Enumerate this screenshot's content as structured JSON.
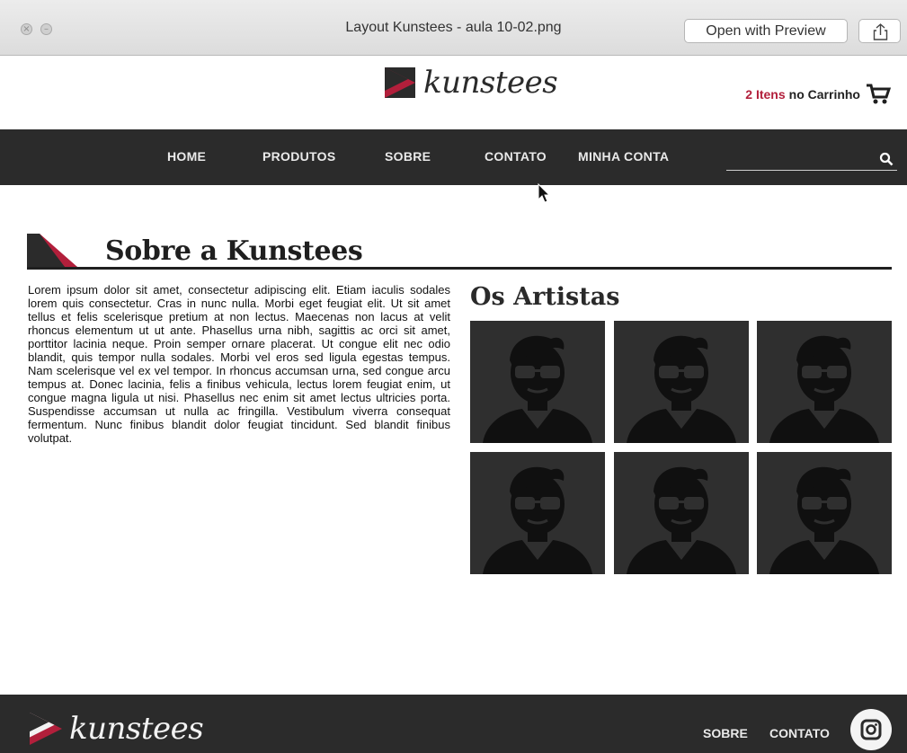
{
  "window": {
    "title": "Layout Kunstees - aula 10-02.png",
    "open_with_preview": "Open with Preview"
  },
  "brand": {
    "name": "kunstees",
    "accent_color": "#b21f3b",
    "dark_color": "#2b2b2b"
  },
  "header": {
    "cart_count": "2 Itens",
    "cart_label": "no Carrinho"
  },
  "nav": {
    "items": [
      "HOME",
      "PRODUTOS",
      "SOBRE",
      "CONTATO",
      "MINHA CONTA"
    ],
    "search_placeholder": ""
  },
  "about": {
    "title": "Sobre a Kunstees",
    "text": "Lorem ipsum dolor sit amet, consectetur adipiscing elit. Etiam iaculis sodales lorem quis consectetur. Cras in nunc nulla. Morbi eget feugiat elit. Ut sit amet tellus et felis scelerisque pretium at non lectus. Maecenas non lacus at velit rhoncus el­ementum ut ut ante. Phasellus urna nibh, sagittis ac orci sit amet, porttitor lacinia neque. Proin semper ornare placerat. Ut congue elit nec odio blandit, quis tempor nulla sodales. Morbi vel eros sed ligula egestas tempus. Nam scelerisque vel ex vel tempor. In rhoncus accumsan urna, sed congue arcu tempus at. Donec lacinia, felis a finibus vehicula, lectus lorem feugiat enim, ut congue magna ligula ut nisi. Phasellus nec enim sit amet lectus ultricies porta. Suspendisse accumsan ut nulla ac fringilla. Vestibulum viverra consequat fermentum. Nunc finibus blandit dolor feugiat tincidunt. Sed blandit fini­bus volutpat."
  },
  "artists": {
    "title": "Os Artistas",
    "count": 6
  },
  "footer": {
    "brand": "kunstees",
    "links": [
      "SOBRE",
      "CONTATO"
    ],
    "icons": [
      "instagram-icon"
    ]
  }
}
